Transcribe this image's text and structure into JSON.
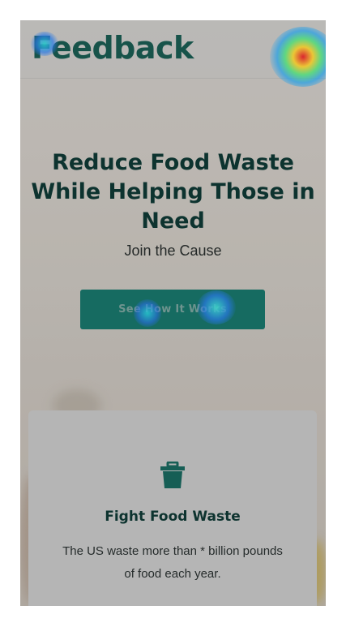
{
  "header": {
    "logo_text": "Feedback"
  },
  "hero": {
    "title": "Reduce Food Waste While Helping Those in Need",
    "subtitle": "Join the Cause",
    "cta_label": "See How It Works"
  },
  "card": {
    "icon": "trash-icon",
    "title": "Fight Food Waste",
    "text": "The US waste more than * billion pounds of food each year."
  },
  "colors": {
    "brand": "#1b5f55",
    "button": "#1a7a6f",
    "heading": "#0f3b36"
  }
}
